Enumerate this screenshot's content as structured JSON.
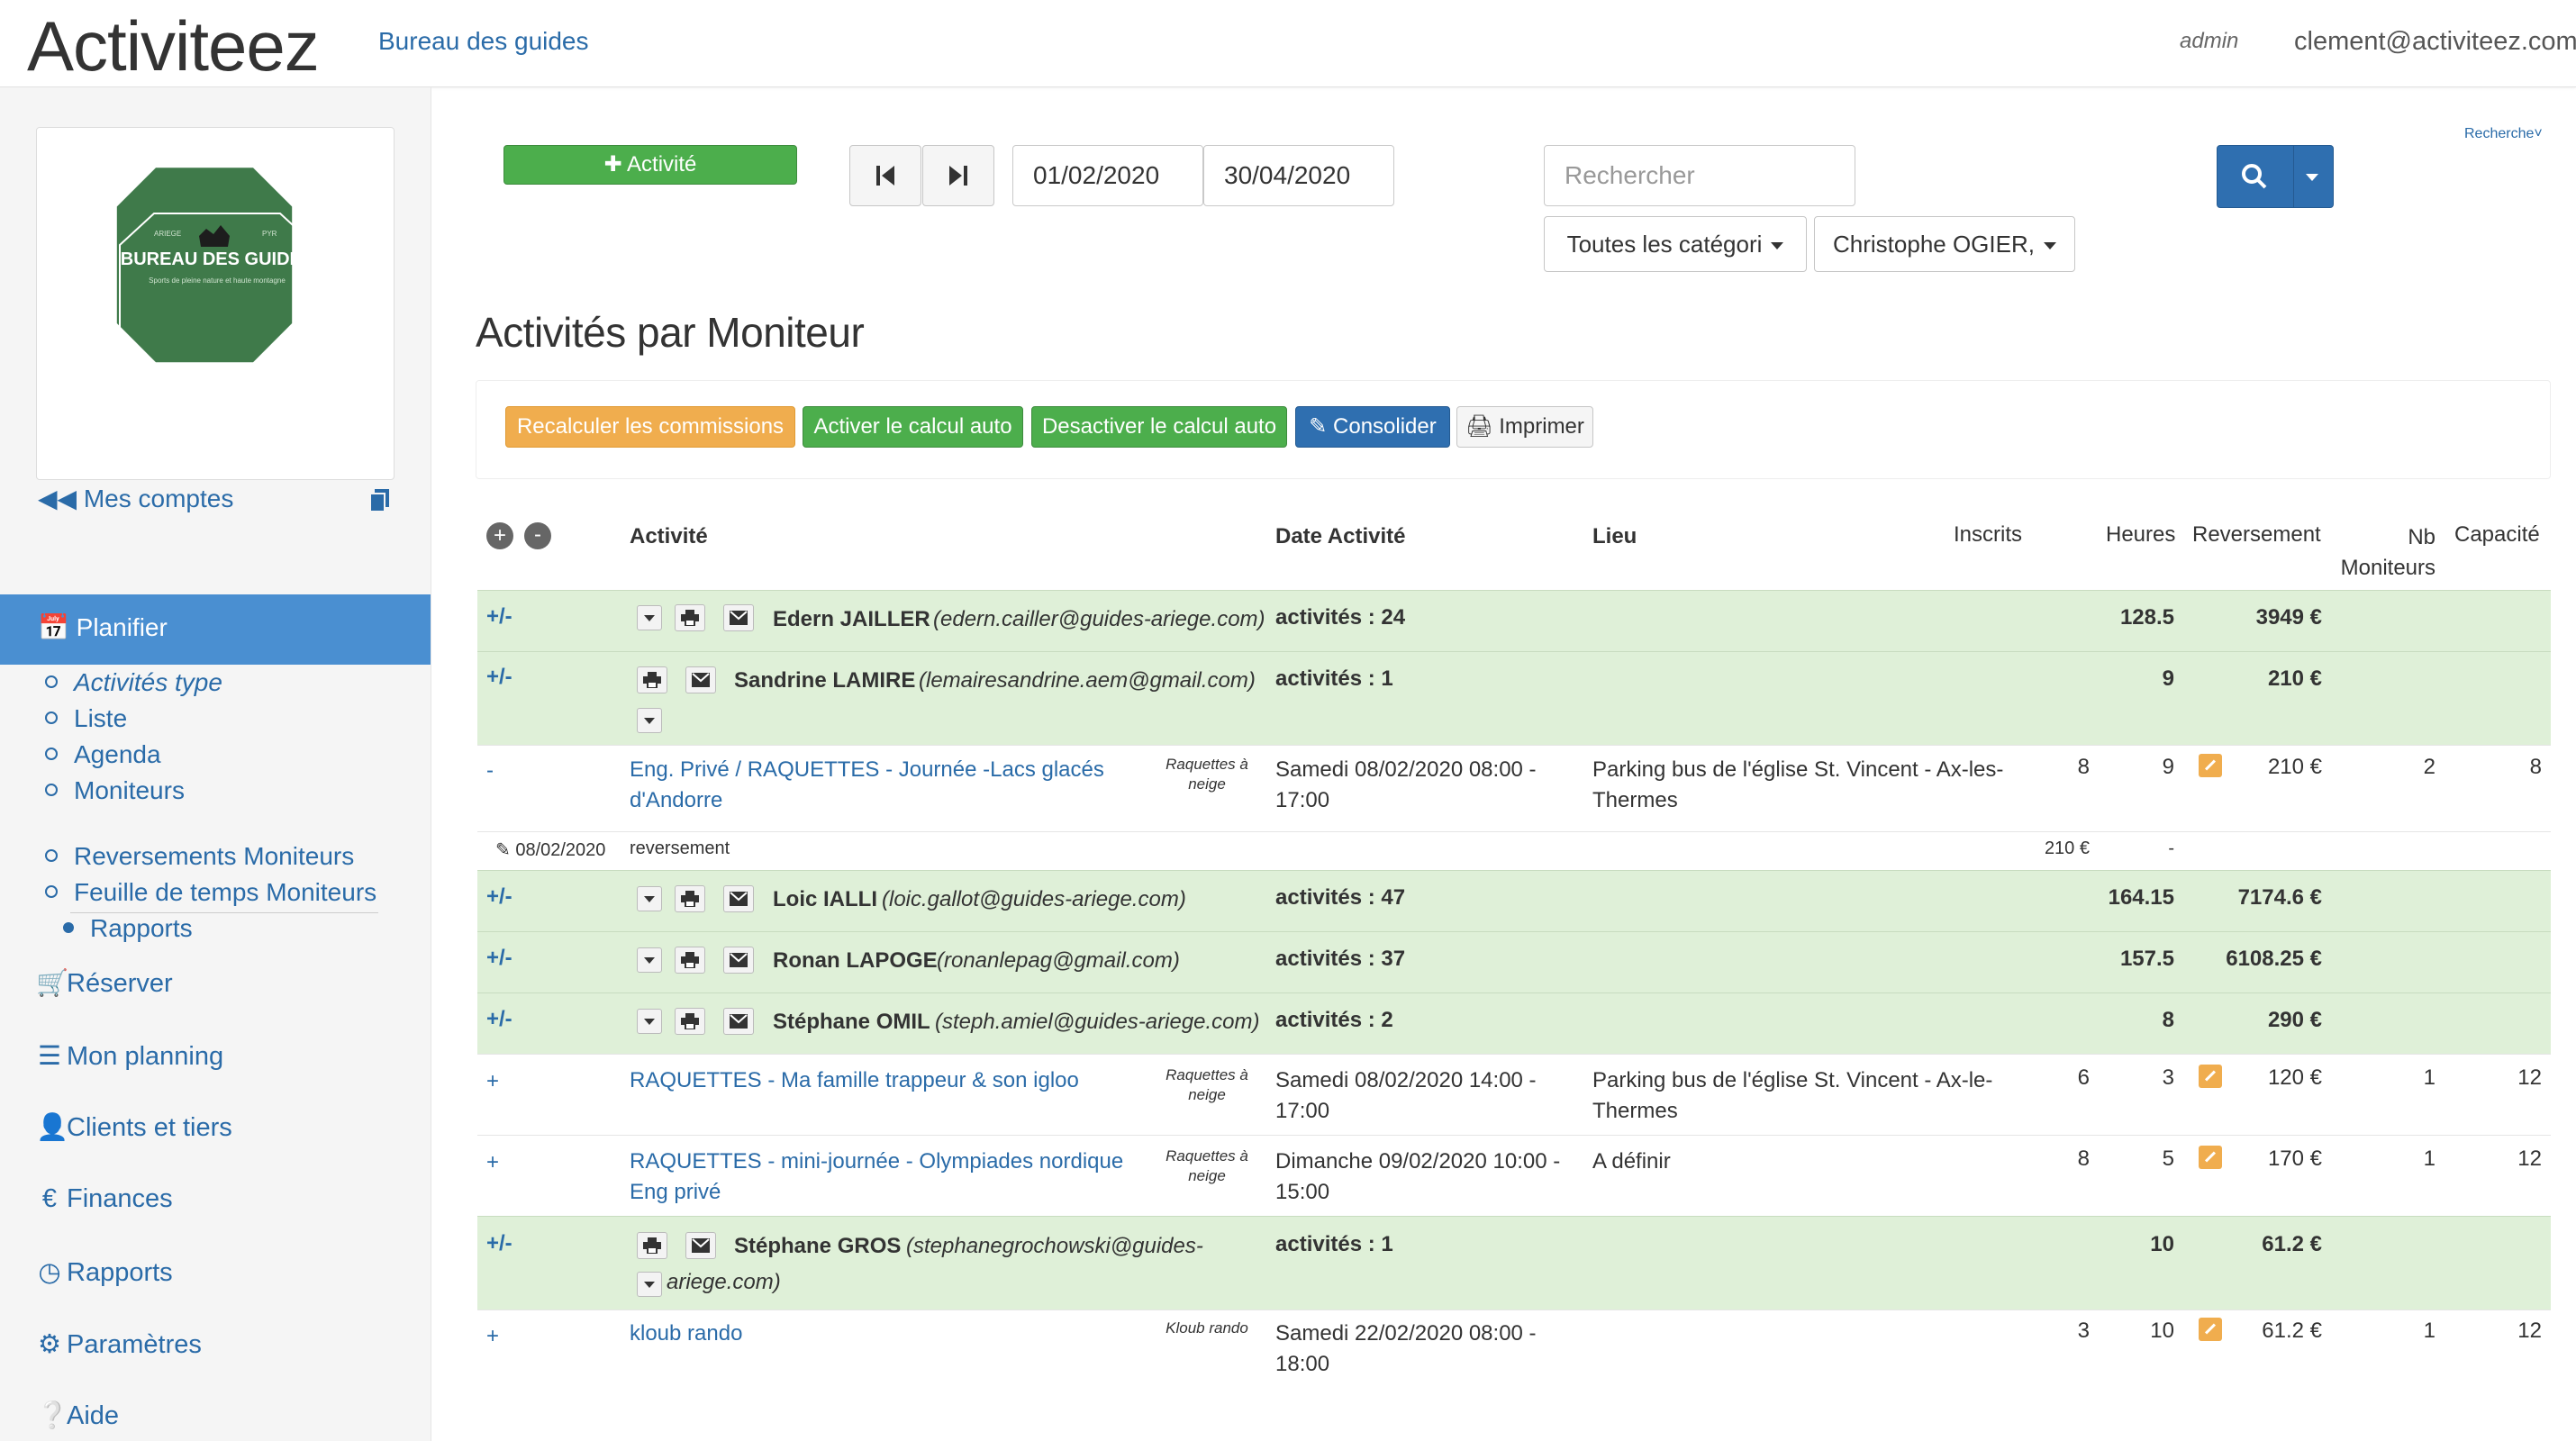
{
  "app": {
    "brand": "Activiteez",
    "company": "Bureau des guides",
    "role": "admin",
    "user_email": "clement@activiteez.com"
  },
  "logo": {
    "line1": "BUREAU DES GUIDES",
    "tagline": "Sports de pleine nature et haute montagne",
    "top_left": "ARIEGE",
    "top_right": "PYR"
  },
  "sidebar": {
    "mes_comptes": "Mes comptes",
    "planifier": "Planifier",
    "sub": [
      "Activités type",
      "Liste",
      "Agenda",
      "Moniteurs"
    ],
    "sub2": [
      "Reversements Moniteurs",
      "Feuille de temps Moniteurs"
    ],
    "sub3": "Rapports",
    "nav": [
      "Réserver",
      "Mon planning",
      "Clients et tiers",
      "Finances",
      "Rapports",
      "Paramètres",
      "Aide"
    ]
  },
  "filters": {
    "add_activity": "Activité",
    "date_from": "01/02/2020",
    "date_to": "30/04/2020",
    "search_placeholder": "Rechercher",
    "category": "Toutes les catégori",
    "moniteur": "Christophe OGIER,",
    "recherche_link": "Recherche"
  },
  "page": {
    "title": "Activités par Moniteur"
  },
  "actions": {
    "recalc": "Recalculer les commissions",
    "activer": "Activer le calcul auto",
    "desactiver": "Desactiver le calcul auto",
    "consolider": "Consolider",
    "imprimer": "Imprimer"
  },
  "table": {
    "headers": {
      "activite": "Activité",
      "date": "Date Activité",
      "lieu": "Lieu",
      "inscrits": "Inscrits",
      "heures": "Heures",
      "reversement": "Reversement",
      "nb_moniteurs_1": "Nb",
      "nb_moniteurs_2": "Moniteurs",
      "capacite": "Capacité"
    },
    "groups": [
      {
        "toggle": "+/-",
        "name": "Edern JAILLER",
        "email": "(edern.cailler@guides-ariege.com)",
        "activites": "activités : 24",
        "heures": "128.5",
        "reversement": "3949 €"
      },
      {
        "toggle": "+/-",
        "name": "Sandrine LAMIRE",
        "email": "(lemairesandrine.aem@gmail.com)",
        "activites": "activités : 1",
        "heures": "9",
        "reversement": "210 €"
      },
      {
        "toggle": "+/-",
        "name": "Loic IALLI",
        "email": "(loic.gallot@guides-ariege.com)",
        "activites": "activités : 47",
        "heures": "164.15",
        "reversement": "7174.6 €"
      },
      {
        "toggle": "+/-",
        "name": "Ronan LAPOGE",
        "email": "(ronanlepag@gmail.com)",
        "activites": "activités : 37",
        "heures": "157.5",
        "reversement": "6108.25 €"
      },
      {
        "toggle": "+/-",
        "name": "Stéphane OMIL",
        "email": "(steph.amiel@guides-ariege.com)",
        "activites": "activités : 2",
        "heures": "8",
        "reversement": "290 €"
      },
      {
        "toggle": "+/-",
        "name": "Stéphane GROS",
        "email_1": "(stephanegrochowski@guides-",
        "email_2": "ariege.com)",
        "activites": "activités : 1",
        "heures": "10",
        "reversement": "61.2 €"
      }
    ],
    "activities": [
      {
        "toggle": "-",
        "title_1": "Eng. Privé / RAQUETTES - Journée -Lacs glacés",
        "title_2": "d'Andorre",
        "type_1": "Raquettes à",
        "type_2": "neige",
        "date_1": "Samedi 08/02/2020 08:00 -",
        "date_2": "17:00",
        "lieu_1": "Parking bus de l'église St. Vincent - Ax-les-",
        "lieu_2": "Thermes",
        "inscrits": "8",
        "heures": "9",
        "reversement": "210 €",
        "nb_moniteurs": "2",
        "capacite": "8"
      },
      {
        "toggle": "+",
        "title_1": "RAQUETTES - Ma famille trappeur & son igloo",
        "title_2": "",
        "type_1": "Raquettes à",
        "type_2": "neige",
        "date_1": "Samedi 08/02/2020 14:00 -",
        "date_2": "17:00",
        "lieu_1": "Parking bus de l'église St. Vincent - Ax-le-",
        "lieu_2": "Thermes",
        "inscrits": "6",
        "heures": "3",
        "reversement": "120 €",
        "nb_moniteurs": "1",
        "capacite": "12"
      },
      {
        "toggle": "+",
        "title_1": "RAQUETTES - mini-journée - Olympiades nordique",
        "title_2": "Eng privé",
        "type_1": "Raquettes à",
        "type_2": "neige",
        "date_1": "Dimanche 09/02/2020 10:00 -",
        "date_2": "15:00",
        "lieu_1": "A définir",
        "lieu_2": "",
        "inscrits": "8",
        "heures": "5",
        "reversement": "170 €",
        "nb_moniteurs": "1",
        "capacite": "12"
      },
      {
        "toggle": "+",
        "title_1": "kloub rando",
        "title_2": "",
        "type_1": "Kloub rando",
        "type_2": "",
        "date_1": "Samedi 22/02/2020 08:00 -",
        "date_2": "18:00",
        "lieu_1": "",
        "lieu_2": "",
        "inscrits": "3",
        "heures": "10",
        "reversement": "61.2 €",
        "nb_moniteurs": "1",
        "capacite": "12"
      }
    ],
    "reversement_line": {
      "date": "08/02/2020",
      "label": "reversement",
      "amount": "210 €",
      "heures": "-"
    }
  },
  "colors": {
    "accent": "#4a8fd1",
    "link": "#2a6ba8",
    "group_row": "#dff0d8",
    "green_btn": "#4cae4c",
    "orange_btn": "#f0ad4e",
    "logo_green": "#3f7a4a"
  }
}
